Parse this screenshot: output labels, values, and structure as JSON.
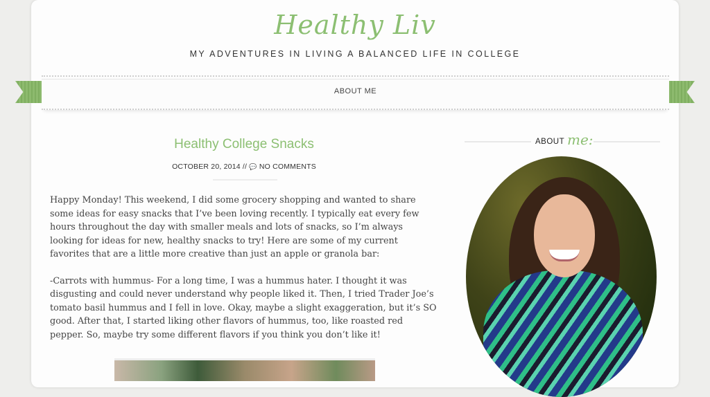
{
  "header": {
    "site_title": "Healthy Liv",
    "tagline": "MY ADVENTURES IN LIVING A BALANCED LIFE IN COLLEGE"
  },
  "nav": {
    "items": [
      {
        "label": "ABOUT ME"
      }
    ]
  },
  "post": {
    "title": "Healthy College Snacks",
    "date": "OCTOBER 20, 2014",
    "meta_separator": " // ",
    "comment_icon": "speech-bubble-icon",
    "comments_link": "NO COMMENTS",
    "paragraphs": [
      "Happy Monday! This weekend, I did some grocery shopping and wanted to share some ideas for easy snacks that I’ve been loving recently. I typically eat every few hours throughout the day with smaller meals and lots of snacks, so I’m always looking for ideas for new, healthy snacks to try! Here are some of my current favorites that are a little more creative than just an apple or granola bar:",
      "-Carrots with hummus- For a long time, I was a hummus hater. I thought it was disgusting and could never understand why people liked it. Then, I tried Trader Joe’s tomato basil hummus and I fell in love. Okay, maybe a slight exaggeration, but it’s SO good. After that, I started liking other flavors of hummus, too, like roasted red pepper. So, maybe try some different flavors if you think you don’t like it!"
    ]
  },
  "sidebar": {
    "about_label": "ABOUT",
    "about_script": "me:"
  },
  "colors": {
    "accent_green": "#8cbf72",
    "text": "#444444"
  }
}
